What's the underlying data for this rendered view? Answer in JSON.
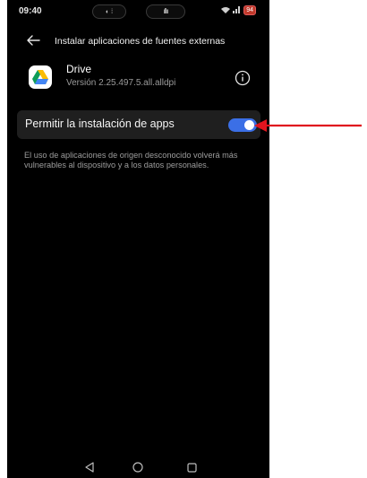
{
  "status_bar": {
    "time": "09:40",
    "pill_left": "⚫ ◑",
    "pill_center": "•••••",
    "signal": "◥",
    "wifi": "≡",
    "battery": "94"
  },
  "header": {
    "title": "Instalar aplicaciones de fuentes externas"
  },
  "app": {
    "name": "Drive",
    "version": "Versión 2.25.497.5.all.alldpi"
  },
  "toggle": {
    "label": "Permitir la instalación de apps",
    "state": "on",
    "accent_color": "#3b6fe6"
  },
  "warning": {
    "text": "El uso de aplicaciones de origen desconocido volverá más vulnerables al dispositivo y a los datos personales."
  },
  "annotation": {
    "arrow_color": "#e0141e"
  },
  "icons": {
    "back": "arrow-left-icon",
    "info": "info-circle-icon",
    "app": "google-drive-icon",
    "nav_back": "triangle-back-icon",
    "nav_home": "circle-home-icon",
    "nav_recent": "square-recent-icon"
  }
}
